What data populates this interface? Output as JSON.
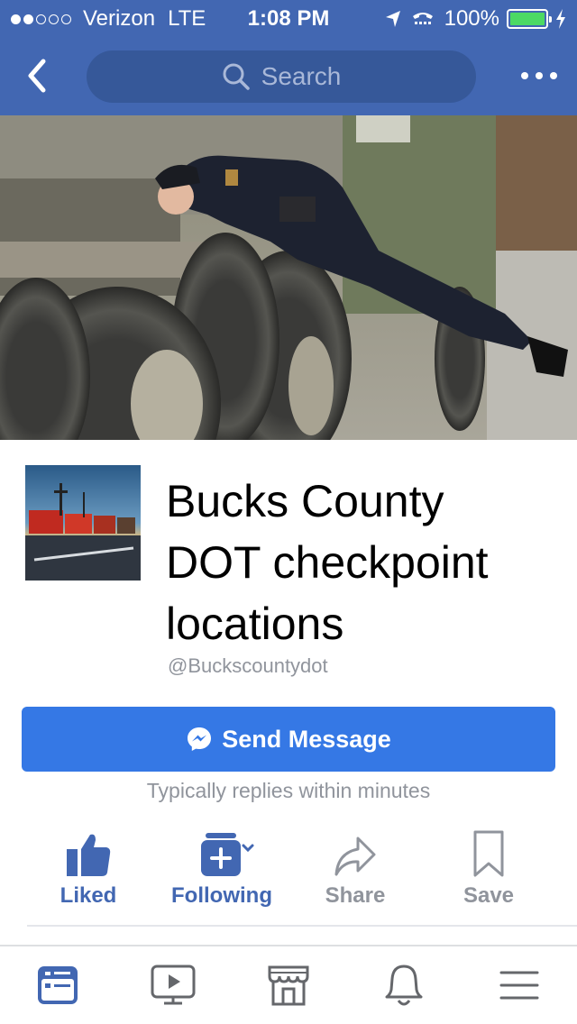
{
  "status_bar": {
    "carrier": "Verizon",
    "network": "LTE",
    "time": "1:08 PM",
    "battery": "100%",
    "signal_strength": 2
  },
  "nav": {
    "search_placeholder": "Search"
  },
  "page": {
    "title_lines": [
      "Bucks County",
      "DOT checkpoint",
      "locations"
    ],
    "handle": "@Buckscountydot"
  },
  "cta": {
    "send_message": "Send Message",
    "reply_note": "Typically replies within minutes"
  },
  "actions": {
    "liked": "Liked",
    "following": "Following",
    "share": "Share",
    "save": "Save"
  },
  "colors": {
    "brand": "#4267b2",
    "button": "#3578e5",
    "muted": "#90949c"
  },
  "tab_bar": {
    "icons": [
      "news-feed-icon",
      "video-icon",
      "marketplace-icon",
      "notifications-icon",
      "menu-icon"
    ]
  }
}
